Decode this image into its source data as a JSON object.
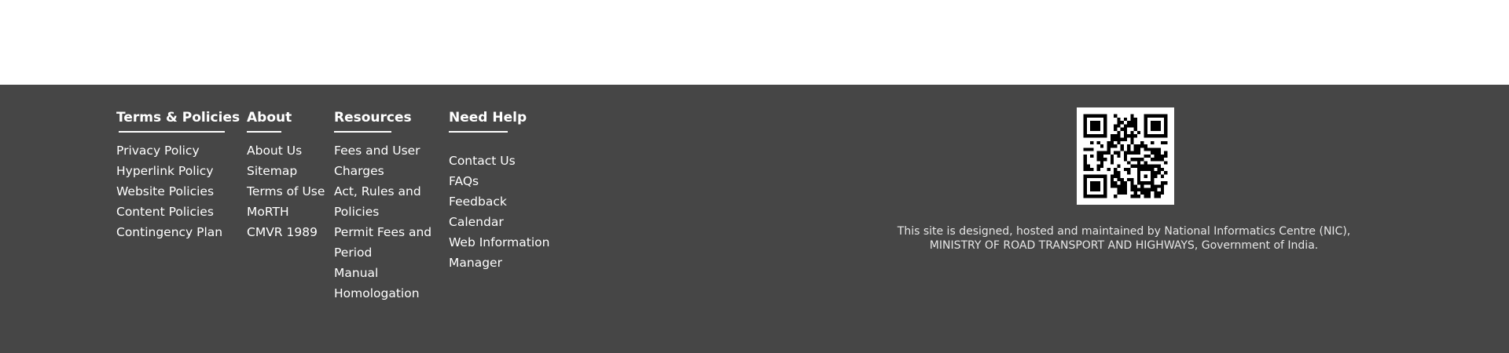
{
  "footer": {
    "columns": [
      {
        "title": "Terms & Policies",
        "links": [
          "Privacy Policy",
          "Hyperlink Policy",
          "Website Policies",
          "Content Policies",
          "Contingency Plan"
        ]
      },
      {
        "title": "About",
        "links": [
          "About Us",
          "Sitemap",
          "Terms of Use",
          "MoRTH",
          "CMVR 1989"
        ]
      },
      {
        "title": "Resources",
        "links": [
          "Fees and User Charges",
          "Act, Rules and Policies",
          "Permit Fees and Period",
          "Manual Homologation"
        ]
      },
      {
        "title": "Need Help",
        "links": [
          "Contact Us",
          "FAQs",
          "Feedback",
          "Calendar",
          "Web Information Manager"
        ]
      }
    ],
    "qr_code_icon": "qr-code",
    "credit_line_1": "This site is designed, hosted and maintained by National Informatics Centre (NIC),",
    "credit_line_2": "MINISTRY OF ROAD TRANSPORT AND HIGHWAYS, Government of India."
  },
  "colors": {
    "footer_background": "#464646",
    "text": "#ffffff"
  }
}
